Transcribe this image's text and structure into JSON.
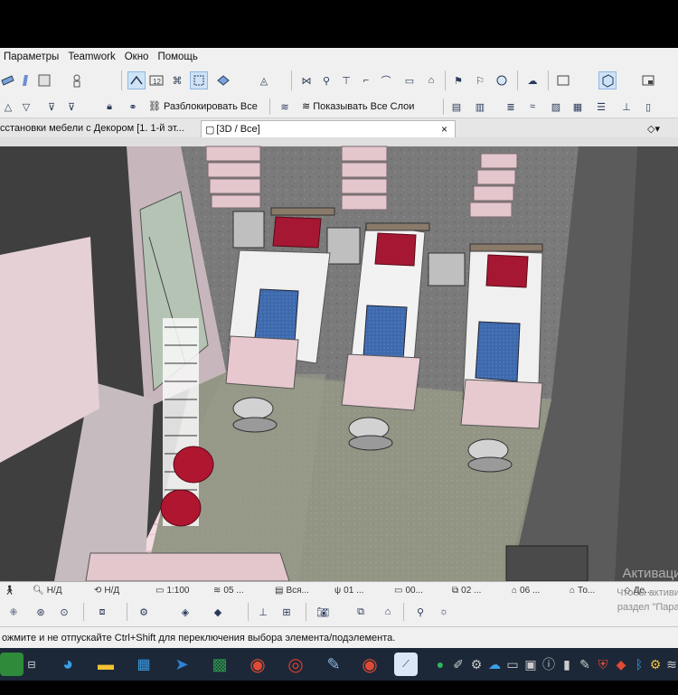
{
  "menu": [
    "Параметры",
    "Teamwork",
    "Окно",
    "Помощь"
  ],
  "toolbar2": {
    "unlock_all": "Разблокировать Все",
    "show_all_layers": "Показывать Все Слои"
  },
  "tabs": [
    {
      "label": "сстановки мебели с Декором [1. 1-й эт..."
    },
    {
      "label": "[3D / Все]"
    }
  ],
  "tab_close": "×",
  "statusbar": {
    "nd1": "Н/Д",
    "nd2": "Н/Д",
    "scale": "1:100",
    "layers": "05 ...",
    "all": "Вся...",
    "pen": "01 ...",
    "model": "00...",
    "view": "02 ...",
    "renov": "06 ...",
    "to": "То...",
    "de": "Де..."
  },
  "hint": "ожмите и не отпускайте Ctrl+Shift для переключения выбора элемента/подэлемента.",
  "watermark": {
    "line1": "Активация W",
    "line2": "Чтобы активиров",
    "line3": "раздел \"Парамет"
  },
  "colors": {
    "accent": "#8fb7e0",
    "bed_blanket": "#3e6aad",
    "pillow": "#a51732",
    "ottoman": "#b0162f",
    "taskbar": "#1c2838"
  },
  "icons": [
    "arrow-icon",
    "pet-palette-icon",
    "magic-wand-icon",
    "3d-view-icon",
    "layers-icon",
    "camera-icon",
    "window-icon"
  ]
}
